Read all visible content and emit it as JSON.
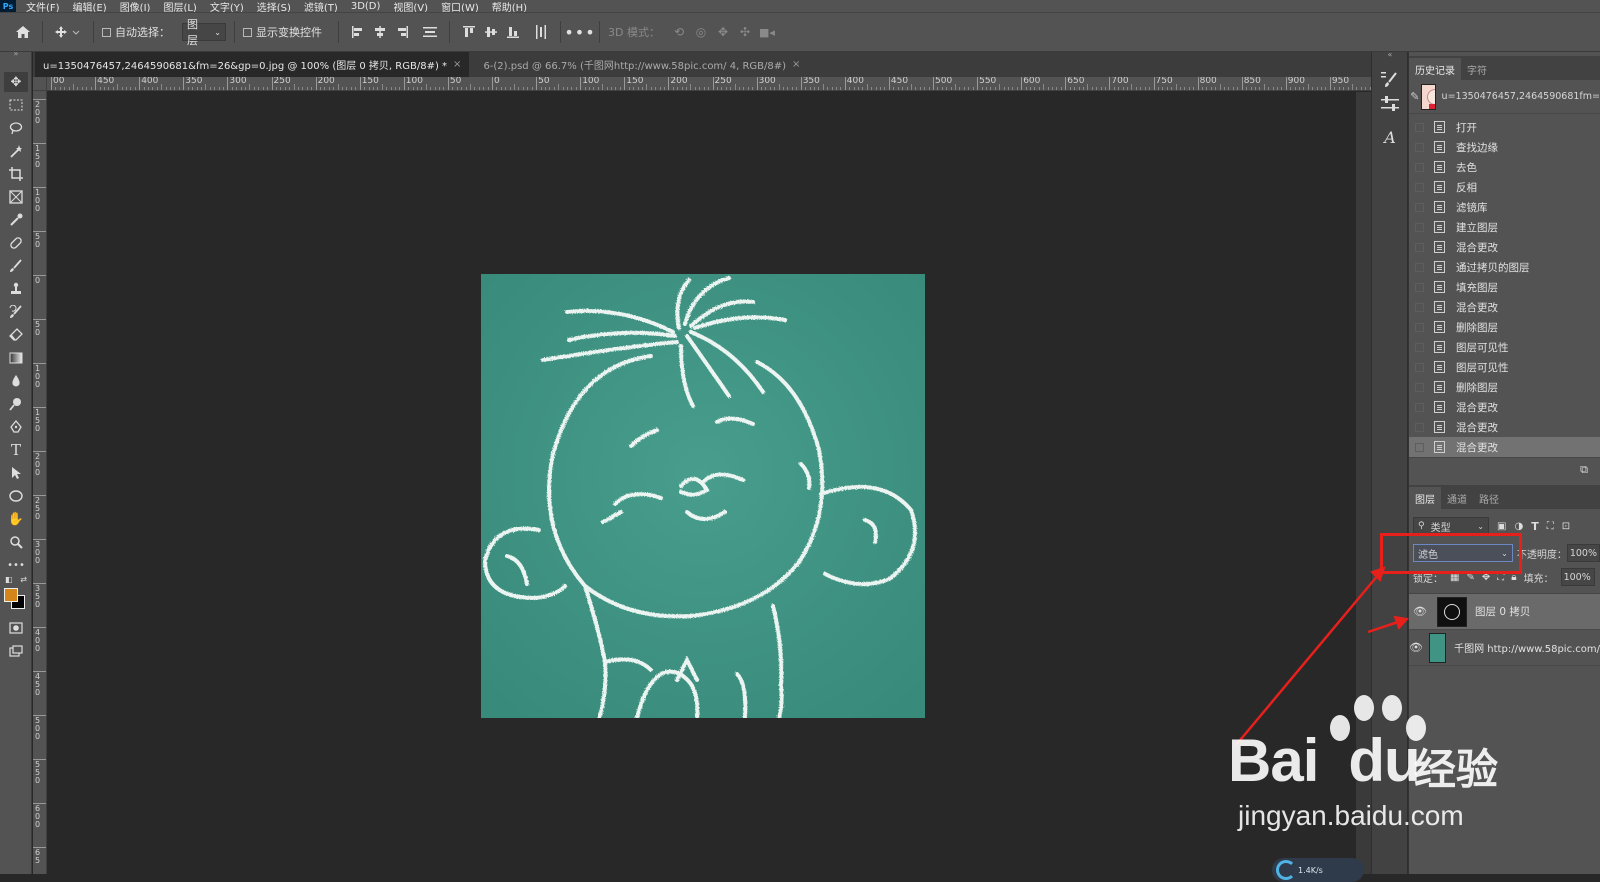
{
  "menubar": {
    "app_logo": "Ps",
    "items": [
      "文件(F)",
      "编辑(E)",
      "图像(I)",
      "图层(L)",
      "文字(Y)",
      "选择(S)",
      "滤镜(T)",
      "3D(D)",
      "视图(V)",
      "窗口(W)",
      "帮助(H)"
    ]
  },
  "options": {
    "auto_select_label": "自动选择：",
    "auto_select_target": "图层",
    "show_transform_label": "显示变换控件",
    "mode_3d_label": "3D 模式："
  },
  "tabs": [
    {
      "label": "u=1350476457,2464590681&fm=26&gp=0.jpg @ 100% (图层 0 拷贝, RGB/8#) *",
      "close": "×"
    },
    {
      "label": "6-(2).psd @ 66.7% (千图网http://www.58pic.com/ 4, RGB/8#)",
      "close": "×"
    }
  ],
  "ruler": {
    "h_ticks": [
      "00",
      "450",
      "400",
      "350",
      "300",
      "250",
      "200",
      "150",
      "100",
      "50",
      "0",
      "50",
      "100",
      "150",
      "200",
      "250",
      "300",
      "350",
      "400",
      "450",
      "500",
      "550",
      "600",
      "650",
      "700",
      "750",
      "800",
      "850",
      "900",
      "950"
    ],
    "v_ticks": [
      "2 0 0",
      "1 5 0",
      "1 0 0",
      "5 0",
      "0",
      "5 0",
      "1 0 0",
      "1 5 0",
      "2 0 0",
      "2 5 0",
      "3 0 0",
      "3 5 0",
      "4 0 0",
      "4 5 0",
      "5 0 0",
      "5 5 0",
      "6 0 0",
      "6 5"
    ]
  },
  "colors": {
    "foreground": "#d5861b",
    "background": "#000000",
    "artwork_bg": "#3f9484",
    "chalk": "#ffffff",
    "annotation": "#e8201c"
  },
  "history": {
    "tab_history": "历史记录",
    "tab_char": "字符",
    "snapshot_name": "u=1350476457,2464590681fm=",
    "items": [
      "打开",
      "查找边缘",
      "去色",
      "反相",
      "滤镜库",
      "建立图层",
      "混合更改",
      "通过拷贝的图层",
      "填充图层",
      "混合更改",
      "删除图层",
      "图层可见性",
      "图层可见性",
      "删除图层",
      "混合更改",
      "混合更改",
      "混合更改"
    ],
    "selected_index": 16
  },
  "layers": {
    "tabs": [
      "图层",
      "通道",
      "路径"
    ],
    "filter_kind": "类型",
    "blend_mode": "滤色",
    "opacity_label": "不透明度：",
    "opacity_value": "100%",
    "lock_label": "锁定：",
    "fill_label": "填充：",
    "fill_value": "100%",
    "items": [
      {
        "name": "图层 0 拷贝",
        "selected": true
      },
      {
        "name": "千图网 http://www.58pic.com/",
        "selected": false
      }
    ]
  },
  "watermark": {
    "brand": "Bai",
    "brand2": "du",
    "cn": "经验",
    "url": "jingyan.baidu.com"
  },
  "status": {
    "readout": "1.4K/s"
  }
}
